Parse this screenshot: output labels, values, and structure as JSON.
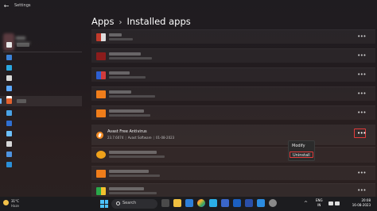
{
  "window": {
    "back_glyph": "←",
    "title": "Settings"
  },
  "breadcrumb": {
    "parent": "Apps",
    "separator": "›",
    "current": "Installed apps"
  },
  "apps": {
    "more_glyph": "•••",
    "featured": {
      "name": "Avast Free Antivirus",
      "version": "23.7.6074",
      "publisher": "Avast Software",
      "date": "01-08-2023",
      "meta_separator": "|"
    }
  },
  "context_menu": {
    "modify_label": "Modify",
    "uninstall_label": "Uninstall"
  },
  "taskbar": {
    "weather_temp": "31°C",
    "weather_condition": "Haze",
    "search_placeholder": "Search",
    "language_line1": "ENG",
    "language_line2": "IN",
    "time": "20:08",
    "date": "16-08-2023",
    "tray_chevron": "^"
  },
  "colors": {
    "accent": "#4cc2ff",
    "highlight": "#e43b3b",
    "avast_orange": "#f08a24"
  }
}
